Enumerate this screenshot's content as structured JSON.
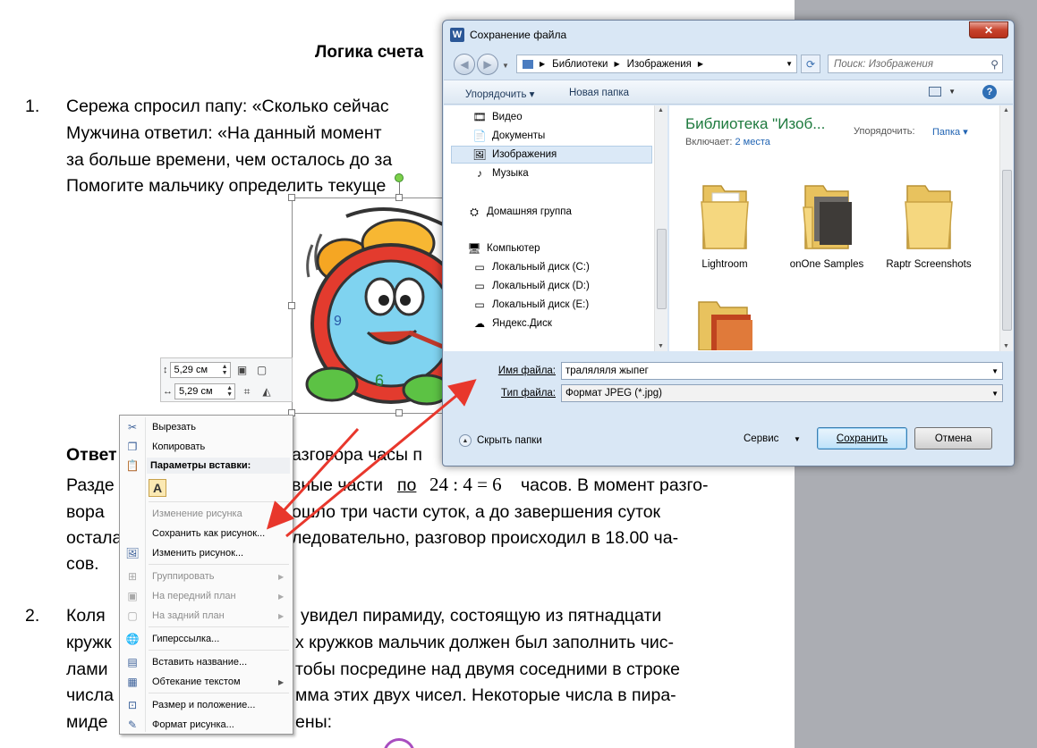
{
  "document": {
    "heading": "Логика счета",
    "p1_num": "1.",
    "p1_l1": "Сережа спросил папу: «Сколько сейчас",
    "p1_l2": "Мужчина ответил: «На данный момент",
    "p1_l3": "за больше времени, чем осталось до за",
    "p1_l4": "Помогите мальчику определить текуще",
    "answer_bold": "Ответ",
    "ans_l1_rest": "азговора часы п",
    "ans_l2_a": "Разде",
    "ans_l2_b": "вные части",
    "ans_l2_po": "по",
    "ans_l2_formula": "24 : 4 = 6",
    "ans_l2_c": "часов. В момент разго-",
    "ans_l3_a": "вора",
    "ans_l3_b": "ошло три части суток, а до завершения суток",
    "ans_l4_a": "остала",
    "ans_l4_b": "ледовательно, разговор происходил в 18.00 ча-",
    "ans_l5": "сов.",
    "p2_num": "2.",
    "p2_l1_a": "Коля",
    "p2_l1_b": "увидел пирамиду, состоящую из пятнадцати",
    "p2_l2_a": "кружк",
    "p2_l2_b": "х кружков мальчик должен был заполнить чис-",
    "p2_l3_a": "лами",
    "p2_l3_b": "тобы посредине над двумя соседними в строке",
    "p2_l4_a": "числа",
    "p2_l4_b": "мма этих двух чисел. Некоторые числа в пира-",
    "p2_l5_a": "миде",
    "p2_l5_b": "ены:"
  },
  "mini_toolbar": {
    "height_value": "5,29 см",
    "width_value": "5,29 см"
  },
  "context_menu": {
    "cut": "Вырезать",
    "copy": "Копировать",
    "paste_header": "Параметры вставки:",
    "paste_option": "A",
    "change_picture_disabled": "Изменение рисунка",
    "save_as_picture": "Сохранить как рисунок...",
    "change_picture": "Изменить рисунок...",
    "group": "Группировать",
    "bring_forward": "На передний план",
    "send_back": "На задний план",
    "hyperlink": "Гиперссылка...",
    "insert_caption": "Вставить название...",
    "text_wrap": "Обтекание текстом",
    "size_position": "Размер и положение...",
    "format_picture": "Формат рисунка..."
  },
  "dialog": {
    "title": "Сохранение файла",
    "close_label": "✕",
    "breadcrumb": [
      "Библиотеки",
      "Изображения"
    ],
    "search_placeholder": "Поиск: Изображения",
    "organize": "Упорядочить ▾",
    "new_folder": "Новая папка",
    "nav_items": {
      "video": "Видео",
      "documents": "Документы",
      "images": "Изображения",
      "music": "Музыка",
      "homegroup": "Домашняя группа",
      "computer": "Компьютер",
      "disk_c": "Локальный диск (C:)",
      "disk_d": "Локальный диск (D:)",
      "disk_e": "Локальный диск (E:)",
      "yandex": "Яндекс.Диск"
    },
    "library_title": "Библиотека \"Изоб...",
    "includes_label": "Включает:",
    "includes_value": "2 места",
    "arrange_label": "Упорядочить:",
    "arrange_value": "Папка ▾",
    "folders": [
      "Lightroom",
      "onOne Samples",
      "Raptr Screenshots",
      ""
    ],
    "filename_label": "Имя файла:",
    "filename_value": "траляляля жыпег",
    "filetype_label": "Тип файла:",
    "filetype_value": "Формат JPEG (*.jpg)",
    "hide_folders": "Скрыть папки",
    "service": "Сервис",
    "save": "Сохранить",
    "cancel": "Отмена"
  },
  "colors": {
    "arrow": "#e8372c",
    "library_title": "#1e7a3e",
    "link": "#2164b3"
  }
}
